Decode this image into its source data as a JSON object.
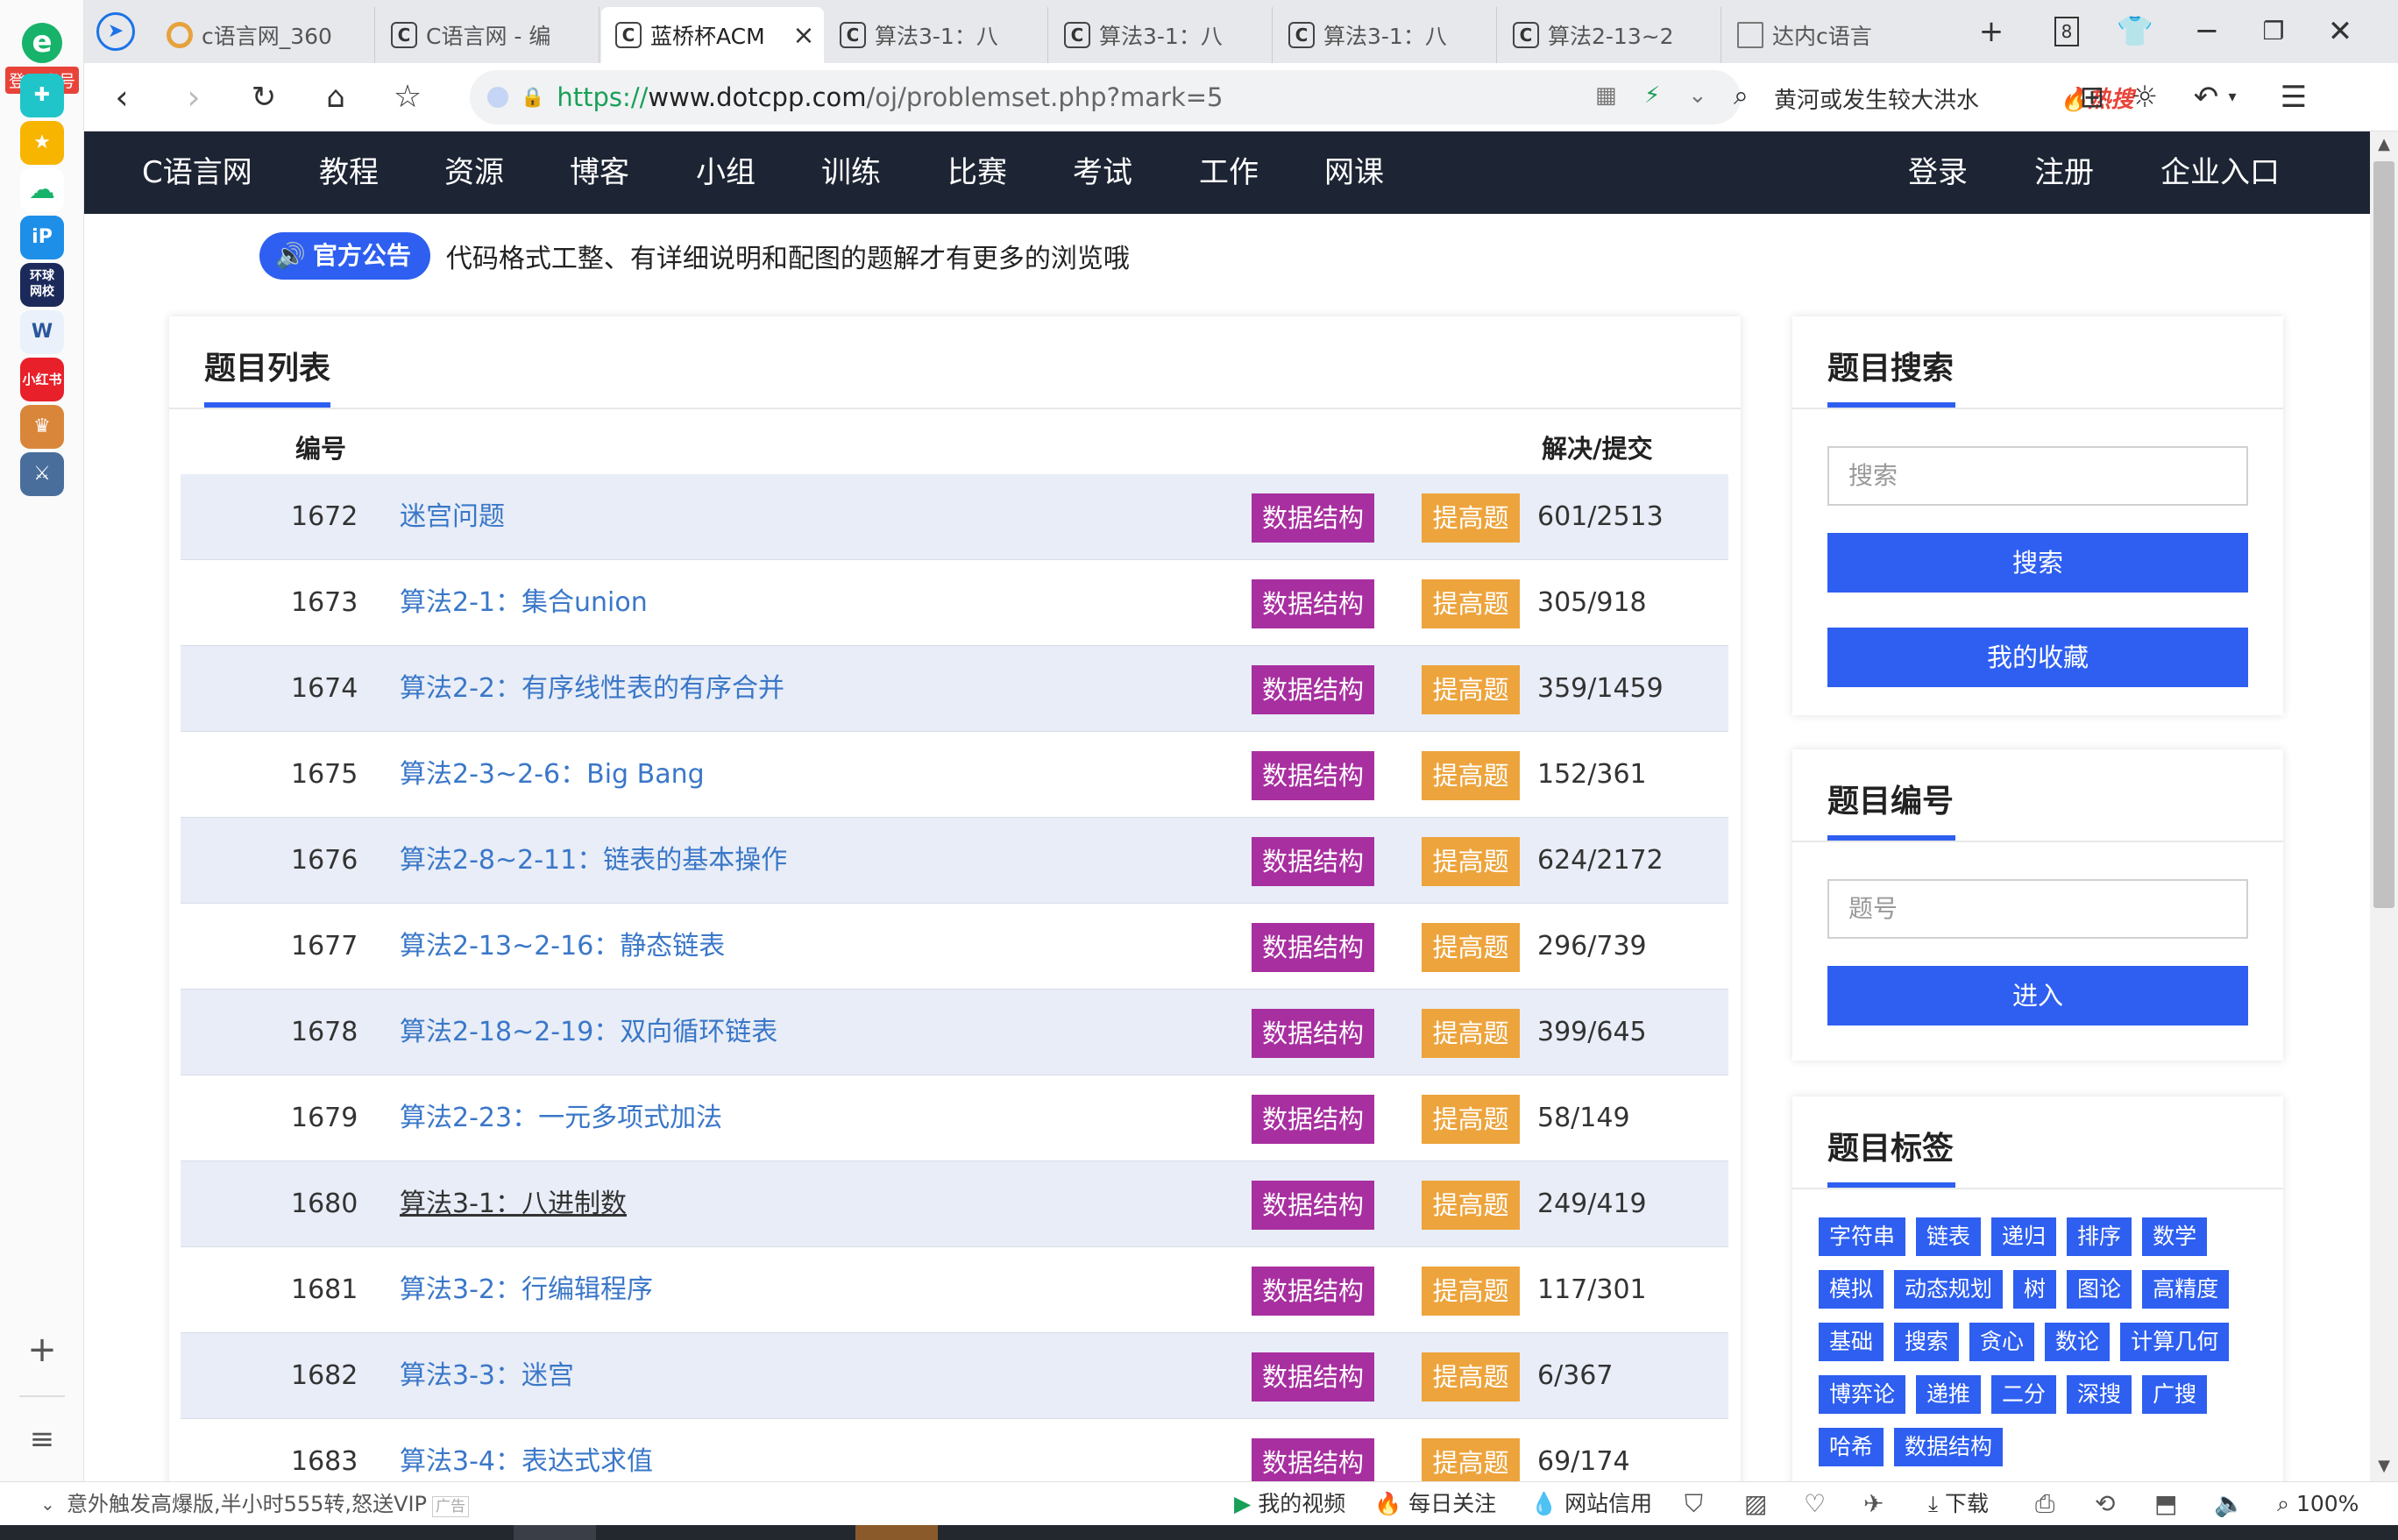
{
  "left_bar": {
    "account_label": "登录账号",
    "bottom_add": "+",
    "bottom_list": "≡"
  },
  "tabs": [
    {
      "title": "c语言网_360",
      "favicon": "circle"
    },
    {
      "title": "C语言网 - 编",
      "favicon": "C"
    },
    {
      "title": "蓝桥杯ACM",
      "favicon": "C",
      "active": true
    },
    {
      "title": "算法3-1：八",
      "favicon": "C"
    },
    {
      "title": "算法3-1：八",
      "favicon": "C"
    },
    {
      "title": "算法3-1：八",
      "favicon": "C"
    },
    {
      "title": "算法2-13~2",
      "favicon": "C"
    },
    {
      "title": "达内c语言",
      "favicon": "doc"
    }
  ],
  "tabstrip": {
    "new_tab": "+",
    "tab_count": "8"
  },
  "address": {
    "scheme": "https://",
    "host": "www.dotcpp.com",
    "path": "/oj/problemset.php?mark=5"
  },
  "search": {
    "query": "黄河或发生较大洪水",
    "hot_label": "热搜"
  },
  "site_nav": {
    "brand": "C语言网",
    "items": [
      "教程",
      "资源",
      "博客",
      "小组",
      "训练",
      "比赛",
      "考试",
      "工作",
      "网课"
    ],
    "right": [
      "登录",
      "注册",
      "企业入口"
    ]
  },
  "announcement": {
    "badge": "官方公告",
    "text": "代码格式工整、有详细说明和配图的题解才有更多的浏览哦"
  },
  "problem_list": {
    "title": "题目列表",
    "col_id": "编号",
    "col_ratio": "解决/提交",
    "rows": [
      {
        "id": "1672",
        "title": "迷宫问题",
        "tag1": "数据结构",
        "tag2": "提高题",
        "ratio": "601/2513"
      },
      {
        "id": "1673",
        "title": "算法2-1：集合union",
        "tag1": "数据结构",
        "tag2": "提高题",
        "ratio": "305/918"
      },
      {
        "id": "1674",
        "title": "算法2-2：有序线性表的有序合并",
        "tag1": "数据结构",
        "tag2": "提高题",
        "ratio": "359/1459"
      },
      {
        "id": "1675",
        "title": "算法2-3~2-6：Big Bang",
        "tag1": "数据结构",
        "tag2": "提高题",
        "ratio": "152/361"
      },
      {
        "id": "1676",
        "title": "算法2-8~2-11：链表的基本操作",
        "tag1": "数据结构",
        "tag2": "提高题",
        "ratio": "624/2172"
      },
      {
        "id": "1677",
        "title": "算法2-13~2-16：静态链表",
        "tag1": "数据结构",
        "tag2": "提高题",
        "ratio": "296/739"
      },
      {
        "id": "1678",
        "title": "算法2-18~2-19：双向循环链表",
        "tag1": "数据结构",
        "tag2": "提高题",
        "ratio": "399/645"
      },
      {
        "id": "1679",
        "title": "算法2-23：一元多项式加法",
        "tag1": "数据结构",
        "tag2": "提高题",
        "ratio": "58/149"
      },
      {
        "id": "1680",
        "title": "算法3-1：八进制数",
        "tag1": "数据结构",
        "tag2": "提高题",
        "ratio": "249/419"
      },
      {
        "id": "1681",
        "title": "算法3-2：行编辑程序",
        "tag1": "数据结构",
        "tag2": "提高题",
        "ratio": "117/301"
      },
      {
        "id": "1682",
        "title": "算法3-3：迷宫",
        "tag1": "数据结构",
        "tag2": "提高题",
        "ratio": "6/367"
      },
      {
        "id": "1683",
        "title": "算法3-4：表达式求值",
        "tag1": "数据结构",
        "tag2": "提高题",
        "ratio": "69/174"
      }
    ]
  },
  "search_widget": {
    "title": "题目搜索",
    "placeholder": "搜索",
    "search_button": "搜索",
    "favorites_button": "我的收藏"
  },
  "id_widget": {
    "title": "题目编号",
    "placeholder": "题号",
    "enter_button": "进入"
  },
  "tags_widget": {
    "title": "题目标签",
    "tags": [
      "字符串",
      "链表",
      "递归",
      "排序",
      "数学",
      "模拟",
      "动态规划",
      "树",
      "图论",
      "高精度",
      "基础",
      "搜索",
      "贪心",
      "数论",
      "计算几何",
      "博弈论",
      "递推",
      "二分",
      "深搜",
      "广搜",
      "哈希",
      "数据结构"
    ]
  },
  "status_bar": {
    "message": "意外触发高爆版,半小时555转,怒送VIP",
    "ad": "广告",
    "items": [
      "我的视频",
      "每日关注",
      "网站信用",
      "下载",
      "100%"
    ]
  },
  "colors": {
    "accent": "#2e5ff0",
    "nav_bg": "#1d2433",
    "tag_data_structure": "#a82fa0",
    "tag_advanced": "#eda43c",
    "link": "#3a77c8",
    "row_alt": "#e8edf7"
  }
}
